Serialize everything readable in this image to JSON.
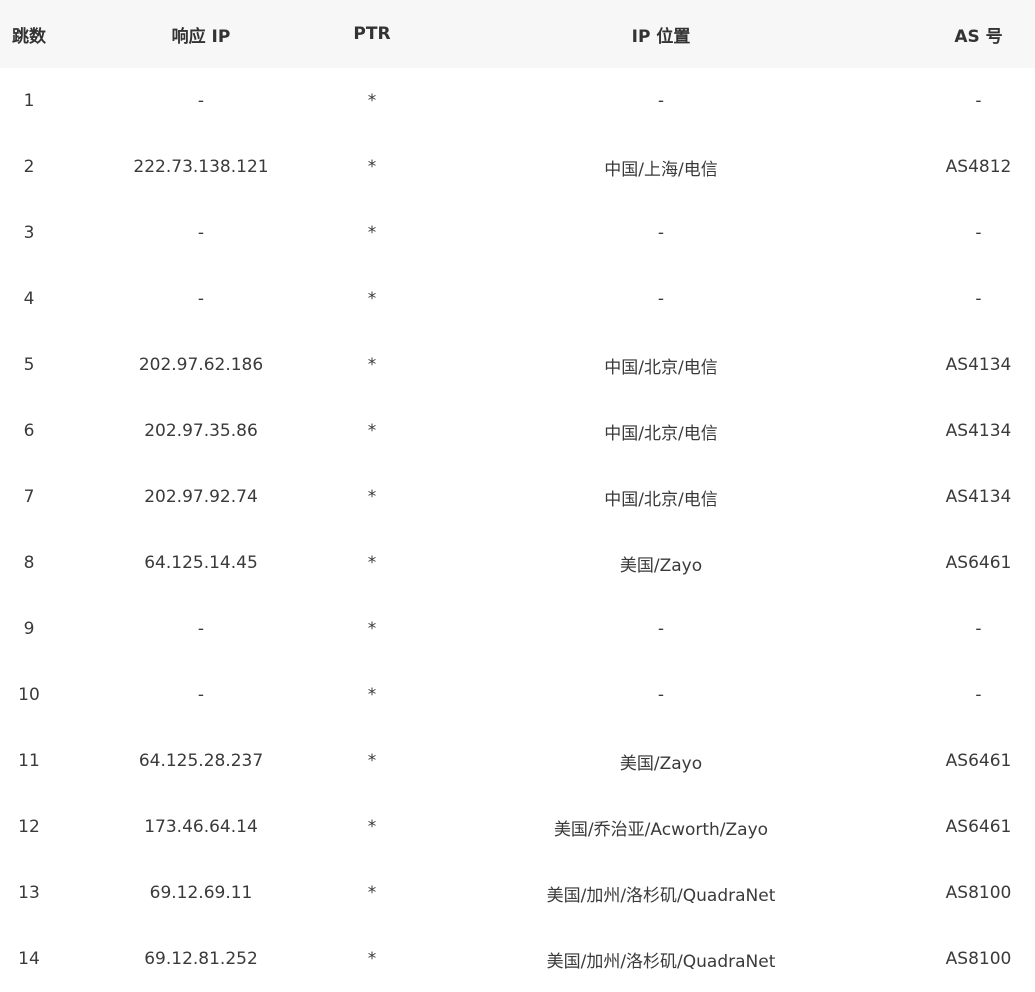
{
  "headers": {
    "hop": "跳数",
    "ip": "响应 IP",
    "ptr": "PTR",
    "location": "IP 位置",
    "as": "AS 号"
  },
  "rows": [
    {
      "hop": "1",
      "ip": "-",
      "ptr": "*",
      "location": "-",
      "as": "-"
    },
    {
      "hop": "2",
      "ip": "222.73.138.121",
      "ptr": "*",
      "location": "中国/上海/电信",
      "as": "AS4812"
    },
    {
      "hop": "3",
      "ip": "-",
      "ptr": "*",
      "location": "-",
      "as": "-"
    },
    {
      "hop": "4",
      "ip": "-",
      "ptr": "*",
      "location": "-",
      "as": "-"
    },
    {
      "hop": "5",
      "ip": "202.97.62.186",
      "ptr": "*",
      "location": "中国/北京/电信",
      "as": "AS4134"
    },
    {
      "hop": "6",
      "ip": "202.97.35.86",
      "ptr": "*",
      "location": "中国/北京/电信",
      "as": "AS4134"
    },
    {
      "hop": "7",
      "ip": "202.97.92.74",
      "ptr": "*",
      "location": "中国/北京/电信",
      "as": "AS4134"
    },
    {
      "hop": "8",
      "ip": "64.125.14.45",
      "ptr": "*",
      "location": "美国/Zayo",
      "as": "AS6461"
    },
    {
      "hop": "9",
      "ip": "-",
      "ptr": "*",
      "location": "-",
      "as": "-"
    },
    {
      "hop": "10",
      "ip": "-",
      "ptr": "*",
      "location": "-",
      "as": "-"
    },
    {
      "hop": "11",
      "ip": "64.125.28.237",
      "ptr": "*",
      "location": "美国/Zayo",
      "as": "AS6461"
    },
    {
      "hop": "12",
      "ip": "173.46.64.14",
      "ptr": "*",
      "location": "美国/乔治亚/Acworth/Zayo",
      "as": "AS6461"
    },
    {
      "hop": "13",
      "ip": "69.12.69.11",
      "ptr": "*",
      "location": "美国/加州/洛杉矶/QuadraNet",
      "as": "AS8100"
    },
    {
      "hop": "14",
      "ip": "69.12.81.252",
      "ptr": "*",
      "location": "美国/加州/洛杉矶/QuadraNet",
      "as": "AS8100"
    }
  ]
}
